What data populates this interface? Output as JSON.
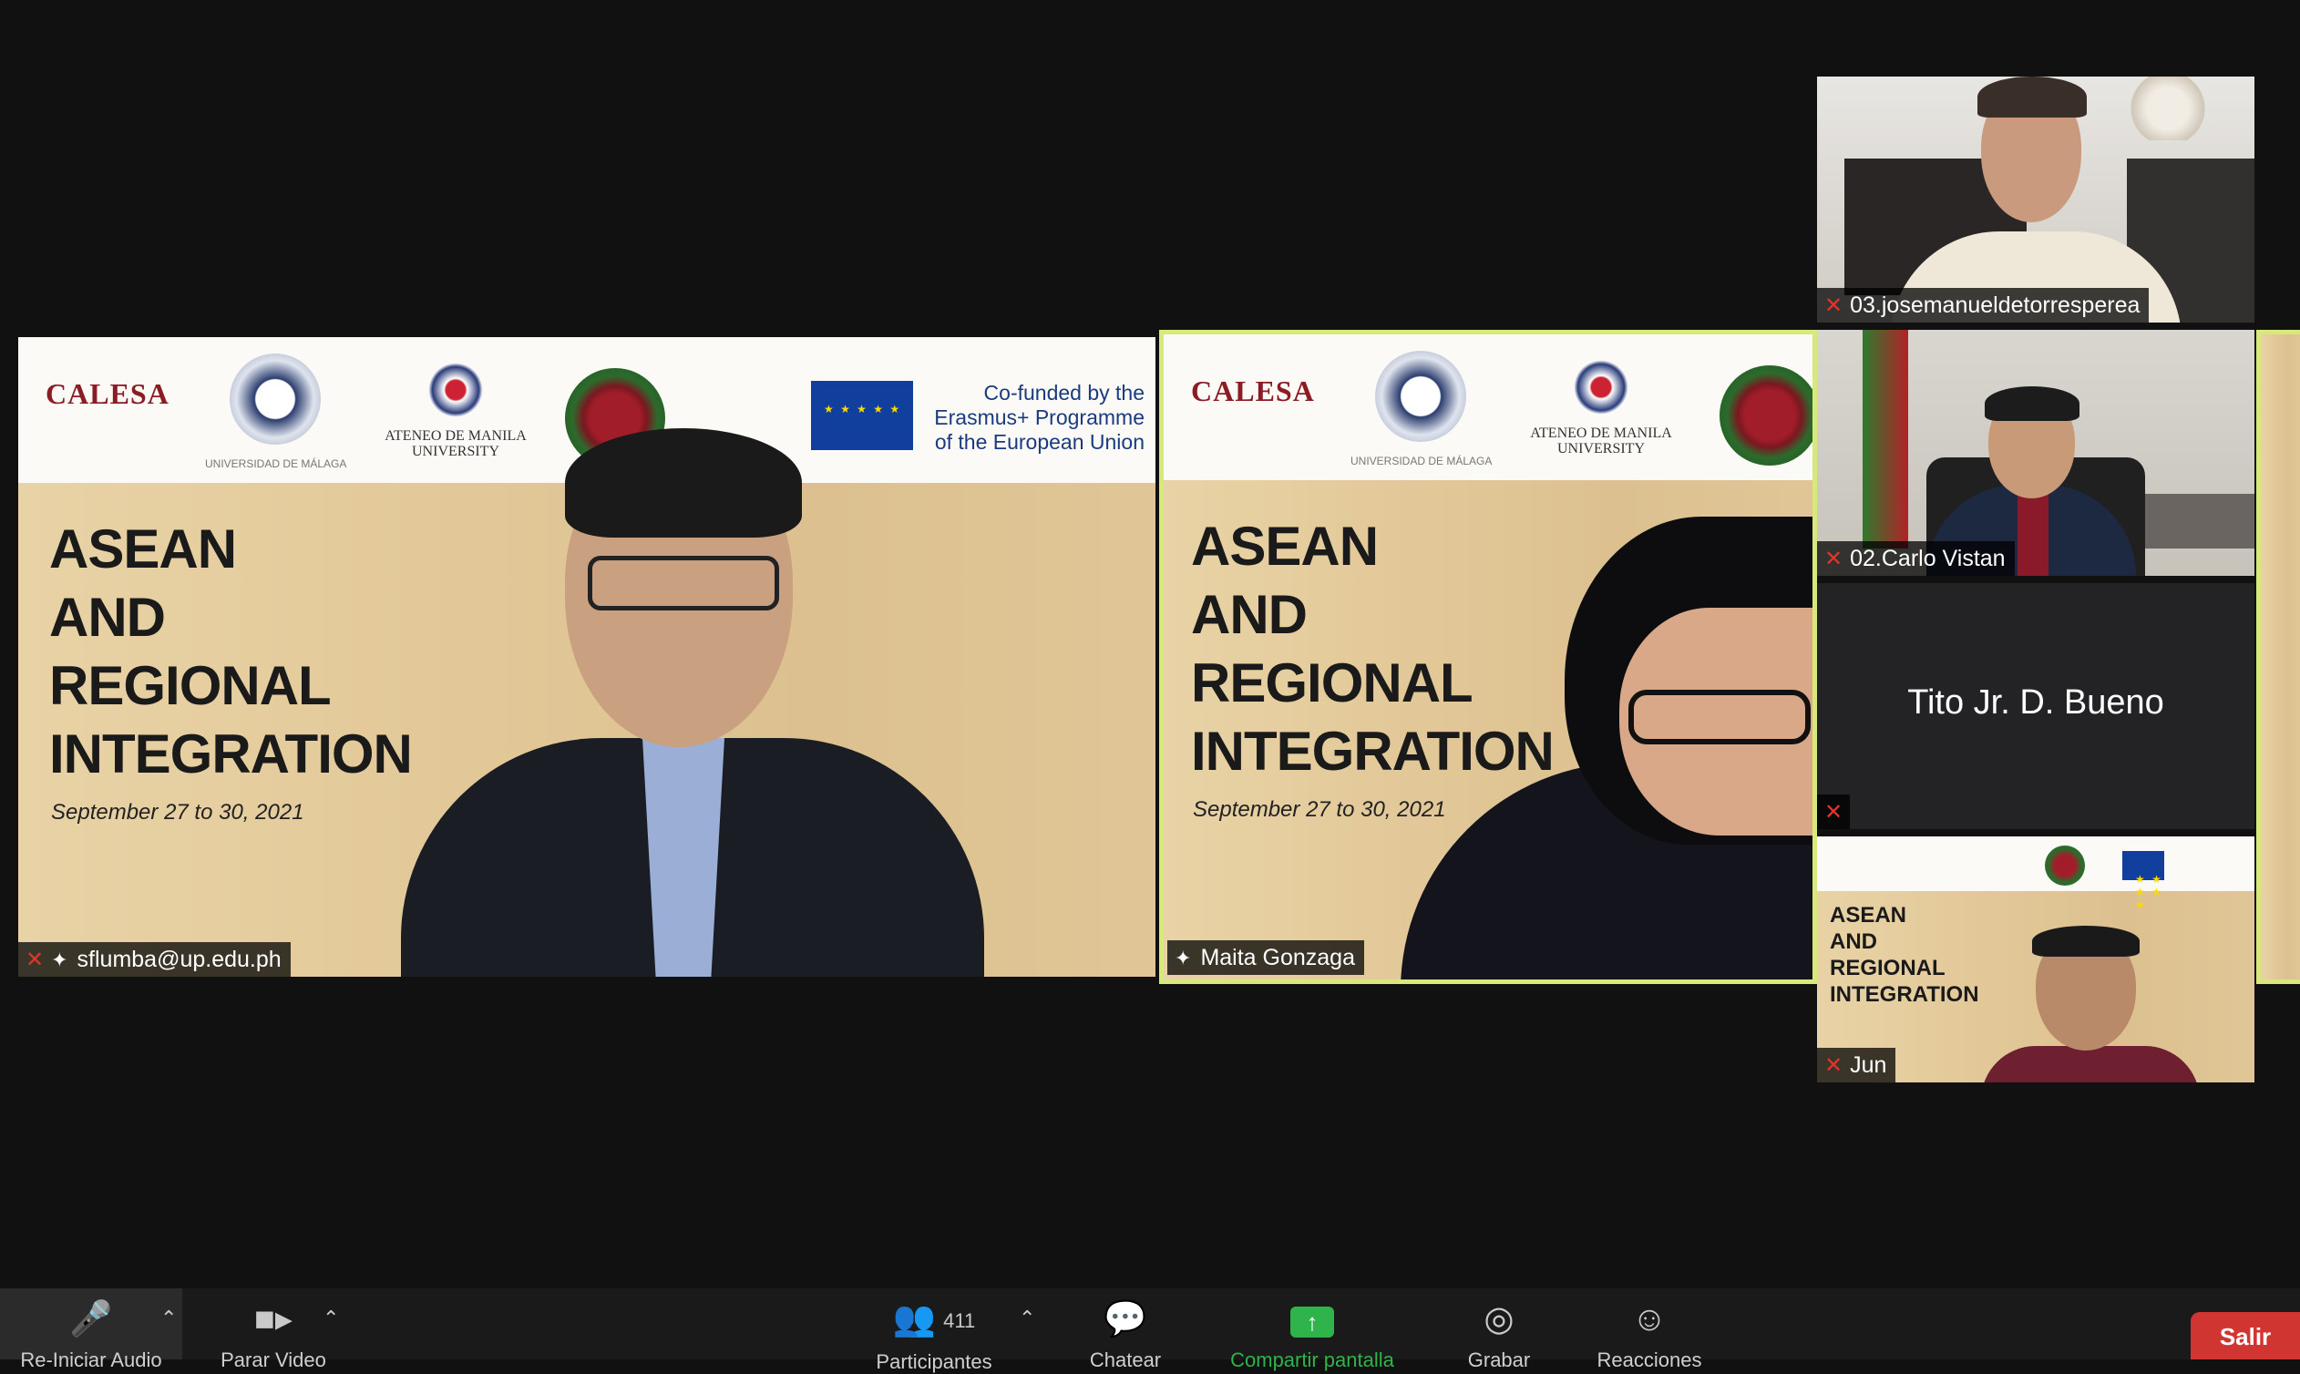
{
  "slide": {
    "logo_calesa": "CALESA",
    "univ_malaga_label": "UNIVERSIDAD DE MÁLAGA",
    "ateneo_label": "ATENEO DE MANILA UNIVERSITY",
    "cofunded_line1": "Co-funded by the",
    "cofunded_line2": "Erasmus+ Programme",
    "cofunded_line3": "of the European Union",
    "title_line1": "ASEAN",
    "title_line2": "AND",
    "title_line3": "REGIONAL",
    "title_line4": "INTEGRATION",
    "date": "September 27 to 30, 2021"
  },
  "participants": {
    "p1": {
      "name": "sflumba@up.edu.ph"
    },
    "p2": {
      "name": "Maita Gonzaga"
    },
    "p3": {
      "name": "03.josemanueldetorresperea"
    },
    "p4": {
      "name": "02.Carlo Vistan"
    },
    "p5": {
      "name": "Tito Jr. D. Bueno"
    },
    "p6": {
      "name": "Jun"
    }
  },
  "toolbar": {
    "audio_label": "Re-Iniciar Audio",
    "video_label": "Parar Video",
    "participants_count": "411",
    "participants_label": "Participantes",
    "chat_label": "Chatear",
    "share_label": "Compartir pantalla",
    "record_label": "Grabar",
    "reactions_label": "Reacciones",
    "leave_label": "Salir"
  },
  "colors": {
    "background": "#111112",
    "active_speaker_border": "#d7e97a",
    "leave_button": "#d13532",
    "share_icon": "#2fb34b",
    "muted_icon": "#e0352b"
  }
}
